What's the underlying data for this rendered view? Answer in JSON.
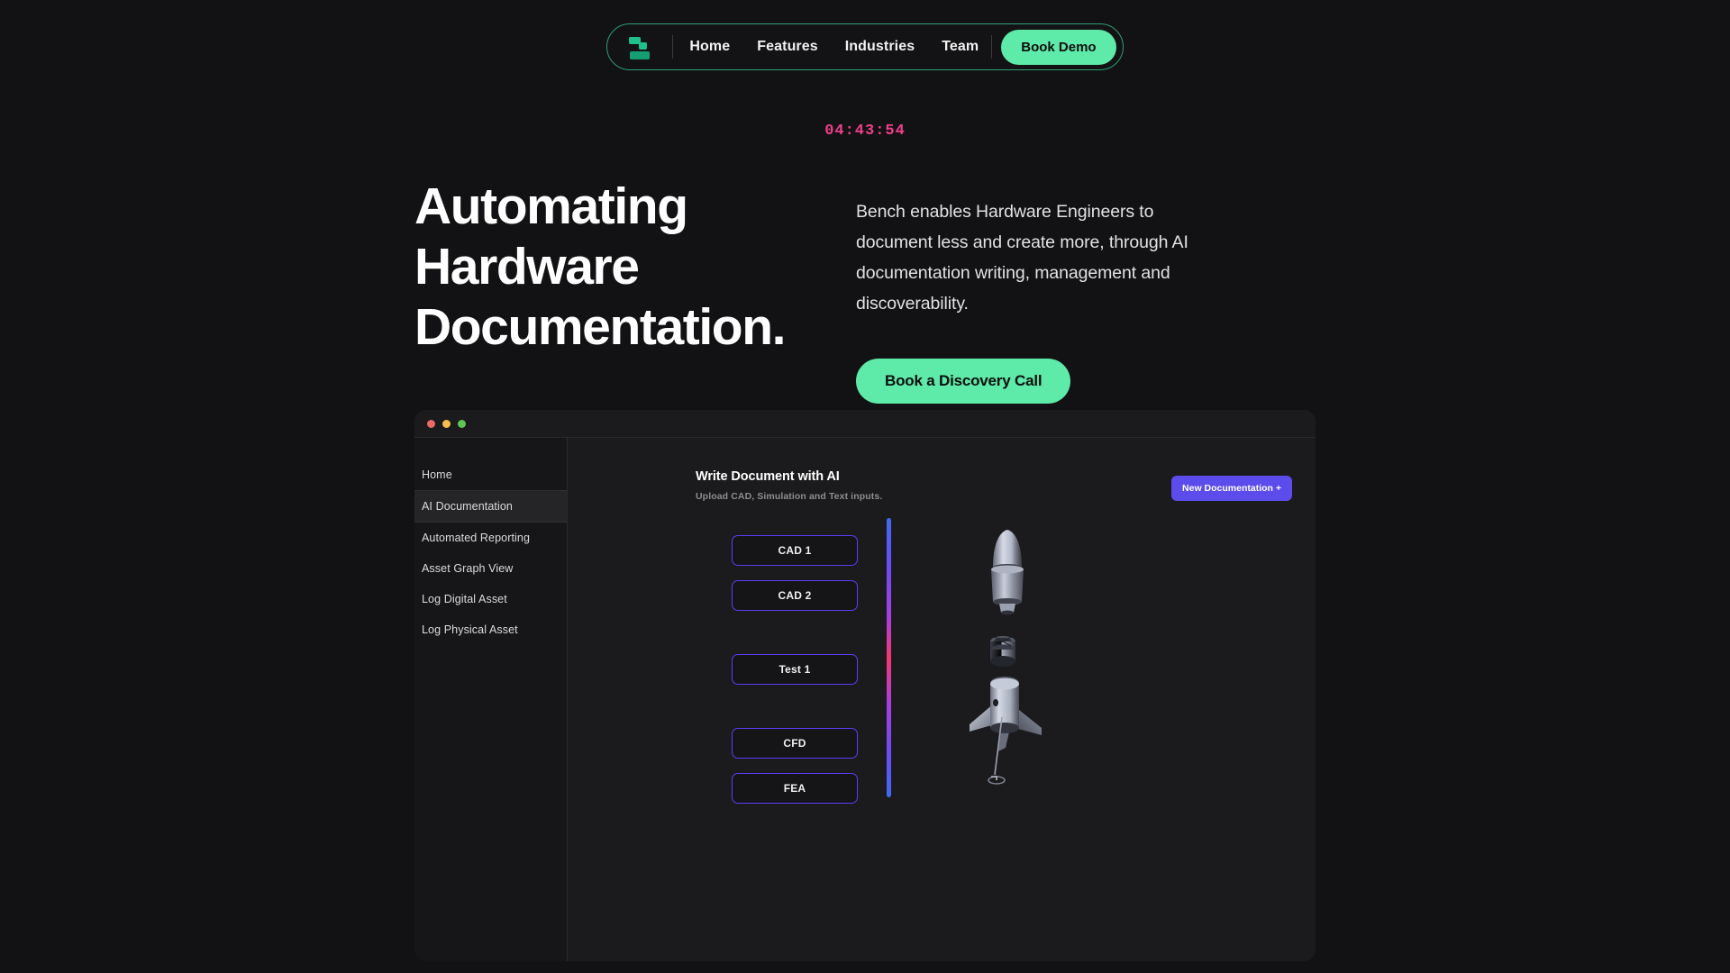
{
  "brand": {
    "logo_icon": "bench-logo-icon",
    "accent_green": "#5eeaa8",
    "accent_purple": "#5b4ceb",
    "accent_pink": "#f0408a"
  },
  "nav": {
    "links": [
      {
        "label": "Home"
      },
      {
        "label": "Features"
      },
      {
        "label": "Industries"
      },
      {
        "label": "Team"
      }
    ],
    "cta_label": "Book Demo"
  },
  "timer": {
    "value": "04:43:54"
  },
  "hero": {
    "title_line_1": "Automating",
    "title_line_2": "Hardware",
    "title_line_3": "Documentation.",
    "paragraph": "Bench enables Hardware Engineers to document less and create more, through AI documentation writing, management and discoverability.",
    "cta_label": "Book a Discovery Call"
  },
  "app": {
    "window_controls": [
      {
        "name": "close",
        "color": "#ed6a5e"
      },
      {
        "name": "minimize",
        "color": "#f4bf4f"
      },
      {
        "name": "maximize",
        "color": "#61c454"
      }
    ],
    "sidebar": {
      "items": [
        {
          "label": "Home",
          "active": false
        },
        {
          "label": "AI Documentation",
          "active": true
        },
        {
          "label": "Automated Reporting",
          "active": false
        },
        {
          "label": "Asset Graph View",
          "active": false
        },
        {
          "label": "Log Digital Asset",
          "active": false
        },
        {
          "label": "Log Physical Asset",
          "active": false
        }
      ]
    },
    "main": {
      "title": "Write Document with AI",
      "subtitle": "Upload CAD, Simulation and Text inputs.",
      "new_doc_label": "New Documentation +",
      "cards": [
        {
          "label": "CAD 1"
        },
        {
          "label": "CAD 2"
        },
        {
          "label": "Test 1"
        },
        {
          "label": "CFD"
        },
        {
          "label": "FEA"
        }
      ],
      "renders": [
        {
          "name": "nose-cone-model"
        },
        {
          "name": "engine-cylinder-model"
        },
        {
          "name": "rocket-fins-model"
        }
      ]
    }
  }
}
